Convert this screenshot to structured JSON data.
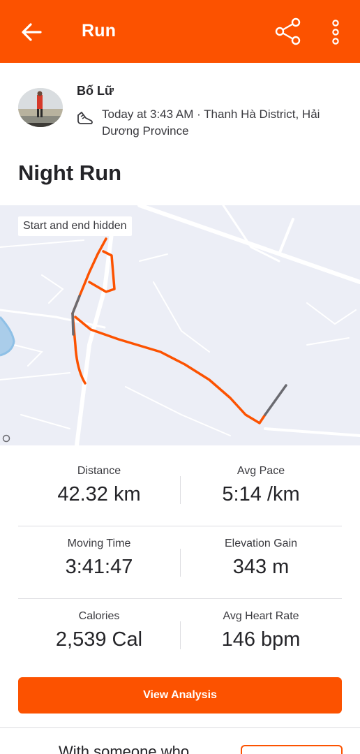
{
  "header": {
    "title": "Run",
    "background": "#fc5200",
    "icons": [
      "back-arrow-icon",
      "share-icon",
      "more-vertical-icon"
    ]
  },
  "athlete": {
    "name": "Bố Lữ",
    "meta": "Today at 3:43 AM · Thanh Hà District, Hải Dương Province",
    "activity_icon": "running-shoe-icon"
  },
  "activity": {
    "title": "Night Run"
  },
  "map": {
    "badge": "Start and end hidden",
    "route_color": "#fc5200"
  },
  "stats": [
    {
      "left": {
        "label": "Distance",
        "value": "42.32 km"
      },
      "right": {
        "label": "Avg Pace",
        "value": "5:14 /km"
      }
    },
    {
      "left": {
        "label": "Moving Time",
        "value": "3:41:47"
      },
      "right": {
        "label": "Elevation Gain",
        "value": "343 m"
      }
    },
    {
      "left": {
        "label": "Calories",
        "value": "2,539 Cal"
      },
      "right": {
        "label": "Avg Heart Rate",
        "value": "146 bpm"
      }
    }
  ],
  "actions": {
    "view_analysis": "View Analysis"
  },
  "footer": {
    "text": "With someone who"
  }
}
